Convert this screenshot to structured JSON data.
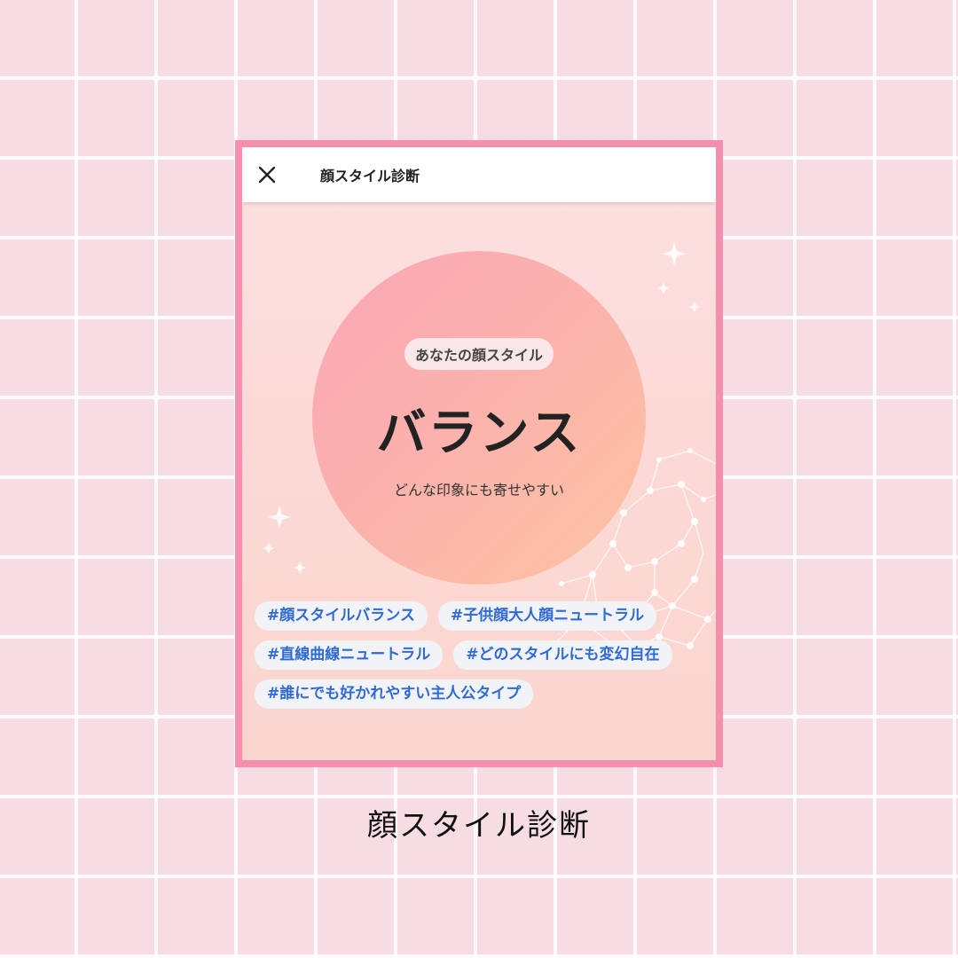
{
  "app": {
    "title": "顔スタイル診断",
    "close_icon": "close-icon"
  },
  "result": {
    "label": "あなたの顔スタイル",
    "title": "バランス",
    "description": "どんな印象にも寄せやすい"
  },
  "tags": [
    "#顔スタイルバランス",
    "#子供顔大人顔ニュートラル",
    "#直線曲線ニュートラル",
    "#どのスタイルにも変幻自在",
    "#誰にでも好かれやすい主人公タイプ"
  ],
  "caption": "顔スタイル診断",
  "colors": {
    "frame_border": "#f68fab",
    "tag_text": "#2f6ad6",
    "background": "#f6dde3"
  }
}
